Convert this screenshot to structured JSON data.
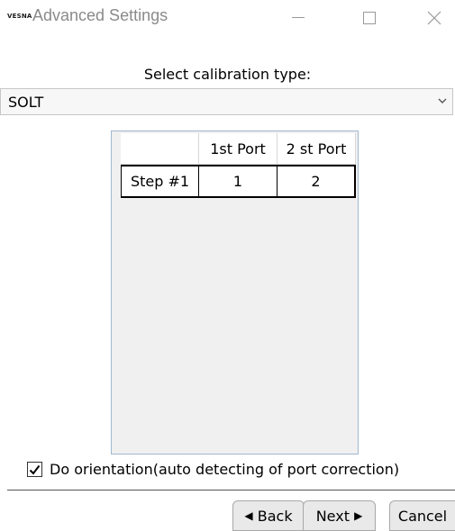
{
  "window": {
    "logo_text": "VESNA",
    "title": "Advanced Settings"
  },
  "calibration": {
    "label": "Select calibration type:",
    "selected": "SOLT"
  },
  "grid": {
    "headers": [
      "",
      "1st Port",
      "2 st Port"
    ],
    "rows": [
      [
        "Step #1",
        "1",
        "2"
      ]
    ]
  },
  "orientation": {
    "checked": true,
    "label": "Do orientation(auto detecting of port correction)"
  },
  "buttons": {
    "back_arrow": "◀",
    "back": "Back",
    "next": "Next",
    "next_arrow": "▶",
    "cancel": "Cancel"
  },
  "icons": {
    "logo": "vesna-logo",
    "minimize": "minimize-icon",
    "maximize": "maximize-icon",
    "close": "close-icon",
    "dropdown": "chevron-down-icon",
    "check": "checkmark-icon"
  }
}
